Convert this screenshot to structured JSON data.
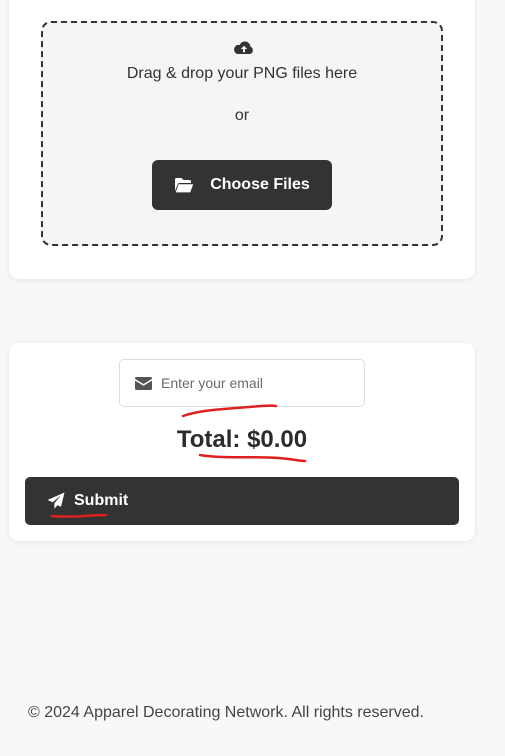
{
  "upload": {
    "icon": "cloud-upload-icon",
    "drop_text": "Drag & drop your PNG files here",
    "or_text": "or",
    "choose_label": "Choose Files",
    "choose_icon": "folder-open-icon"
  },
  "form": {
    "email_icon": "envelope-icon",
    "email_placeholder": "Enter your email",
    "email_value": "",
    "total_text": "Total: $0.00",
    "submit_label": "Submit",
    "submit_icon": "paper-plane-icon"
  },
  "annotation_color": "#e02020",
  "accent_color": "#333333",
  "footer": {
    "text": "© 2024 Apparel Decorating Network. All rights reserved."
  }
}
